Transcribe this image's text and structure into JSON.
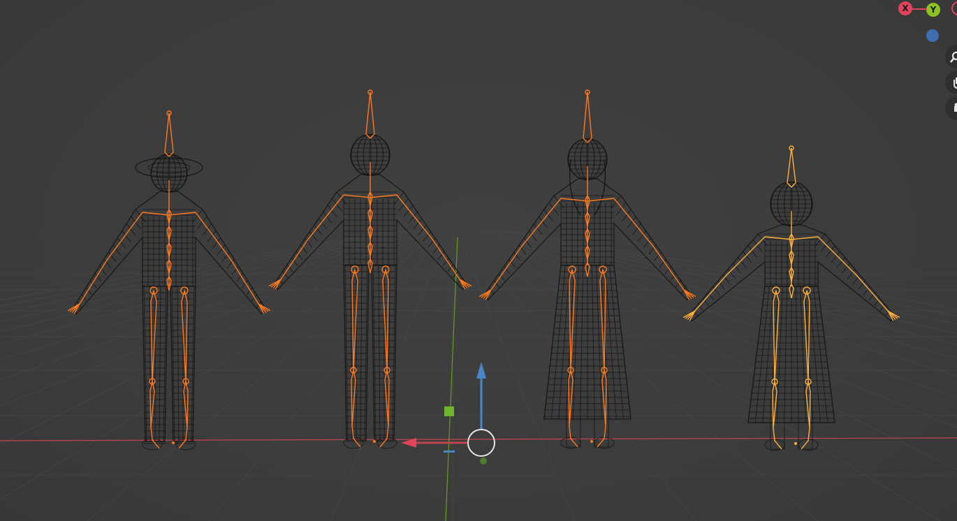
{
  "colors": {
    "background": "#3d3d3d",
    "grid": "#4a4a4a",
    "axis_x": "#c0464f",
    "axis_y": "#6a9a2a",
    "axis_z": "#4a86c8",
    "bone": "#ff7a1e",
    "bone_selected": "#ffb03a",
    "mesh_wire": "#161616"
  },
  "nav_gizmo": {
    "x_label": "X",
    "y_label": "Y",
    "x_color": "#e0445a",
    "y_color": "#8cc320",
    "z_color": "#3e6db0"
  },
  "nav_buttons": [
    {
      "icon": "zoom-icon"
    },
    {
      "icon": "hand-pan-icon"
    },
    {
      "icon": "camera-icon"
    }
  ],
  "characters": [
    {
      "name": "character-hat",
      "outfit": "hat-jacket-pants"
    },
    {
      "name": "character-short-hair",
      "outfit": "jacket-pants"
    },
    {
      "name": "character-long-hair",
      "outfit": "long-dress"
    },
    {
      "name": "character-child",
      "outfit": "dress",
      "selected": true
    }
  ],
  "transform_gizmo": {
    "move_arrows": [
      "x-arrow",
      "z-arrow"
    ],
    "plane_handles": [
      "yz-plane",
      "xy-plane"
    ]
  }
}
